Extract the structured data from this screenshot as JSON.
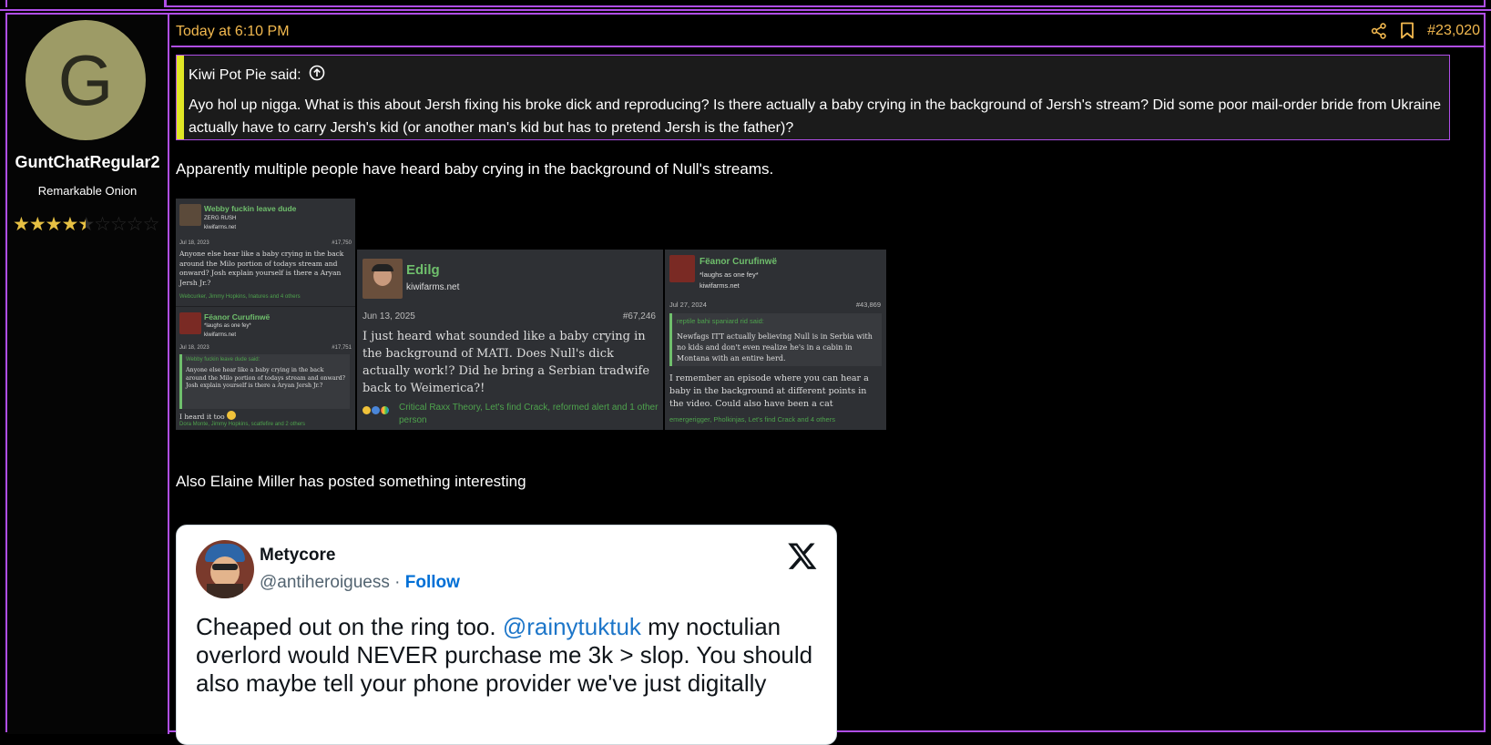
{
  "post": {
    "date": "Today at 6:10 PM",
    "post_number": "#23,020",
    "author": {
      "avatar_letter": "G",
      "username": "GuntChatRegular2",
      "title": "Remarkable Onion",
      "rating_stars": 4.5,
      "rating_max": 10
    },
    "quote": {
      "author_said": "Kiwi Pot Pie said:",
      "text": "Ayo hol up nigga. What is this about Jersh fixing his broke dick and reproducing? Is there actually a baby crying in the background of Jersh's stream? Did some poor mail-order bride from Ukraine actually have to carry Jersh's kid (or another man's kid but has to pretend Jersh is the father)?"
    },
    "paragraph1": "Apparently multiple people have heard baby crying in the background of Null's streams.",
    "paragraph2": "Also Elaine Miller has posted something interesting",
    "screenshots": {
      "card1": {
        "name": "Webby fuckin leave dude",
        "title": "ZERG RUSH",
        "site": "kiwifarms.net",
        "date": "Jul 18, 2023",
        "num": "#17,750",
        "text": "Anyone else hear like a baby crying in the back around the Milo portion of todays stream and onward? Josh explain yourself is there a Aryan Jersh Jr.?",
        "reactions": "Webcurker, Jimmy Hopkins, Inatures and 4 others"
      },
      "card2": {
        "name": "Fëanor Curufinwë",
        "title": "*laughs as one fey*",
        "site": "kiwifarms.net",
        "date": "Jul 18, 2023",
        "num": "#17,751",
        "quote_said": "Webby fuckin leave dude said:",
        "quote_text": "Anyone else hear like a baby crying in the back around the Milo portion of todays stream and onward? Josh explain yourself is there a Aryan Jersh Jr.?",
        "text": "I heard it too",
        "reactions": "Dora Monte, Jimmy Hopkins, scatfefire and 2 others"
      },
      "card3": {
        "name": "Edilg",
        "site": "kiwifarms.net",
        "date": "Jun 13, 2025",
        "num": "#67,246",
        "text": "I just heard what sounded like a baby crying in the background of MATI. Does Null's dick actually work!? Did he bring a Serbian tradwife back to Weimerica?!",
        "reactions": "Critical Raxx Theory, Let's find Crack, reformed alert and 1 other person"
      },
      "card4": {
        "name": "Fëanor Curufinwë",
        "title": "*laughs as one fey*",
        "site": "kiwifarms.net",
        "date": "Jul 27, 2024",
        "num": "#43,869",
        "quote_said": "reptile bahi spaniard rid said:",
        "quote_text": "Newfags ITT actually believing Null is in Serbia with no kids and don't even realize he's in a cabin in Montana with an entire herd.",
        "text": "I remember an episode where you can hear a baby in the background at different points in the video. Could also have been a cat",
        "reactions": "emergerigger, Pholkinjas, Let's find Crack and 4 others"
      }
    },
    "tweet": {
      "display_name": "Metycore",
      "handle": "@antiheroiguess",
      "separator": "·",
      "follow": "Follow",
      "text_before": "Cheaped out on the ring too. ",
      "mention": "@rainytuktuk",
      "text_after": " my noctulian overlord would NEVER purchase me 3k > slop. You should also maybe tell your phone provider we've just digitally"
    }
  },
  "colors": {
    "accent_border": "#b04ee8",
    "date_color": "#f3b94f",
    "quote_bar": "#e0e625",
    "avatar_bg": "#9d9b66",
    "green_name": "#6fbf6c"
  },
  "icons": [
    "share-icon",
    "bookmark-icon",
    "arrow-up-circle-icon",
    "x-logo-icon"
  ]
}
